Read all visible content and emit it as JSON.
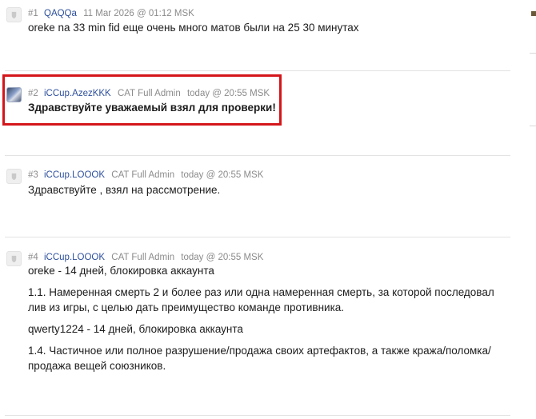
{
  "posts": [
    {
      "num": "#1",
      "user": "QAQQa",
      "role": "",
      "date": "11 Mar 2026 @ 01:12 MSK",
      "avatar_icon": "default-avatar-icon",
      "paragraphs": [
        "oreke na 33 min fid еще очень много матов были на 25 30 минутах"
      ]
    },
    {
      "num": "#2",
      "user": "iCCup.AzezKKK",
      "role": "CAT Full Admin",
      "date": "today @ 20:55 MSK",
      "avatar_icon": "user-photo-avatar",
      "paragraphs": [
        "Здравствуйте уважаемый взял для проверки!"
      ]
    },
    {
      "num": "#3",
      "user": "iCCup.LOOOK",
      "role": "CAT Full Admin",
      "date": "today @ 20:55 MSK",
      "avatar_icon": "default-avatar-icon",
      "paragraphs": [
        "Здравствуйте , взял на рассмотрение."
      ]
    },
    {
      "num": "#4",
      "user": "iCCup.LOOOK",
      "role": "CAT Full Admin",
      "date": "today @ 20:55 MSK",
      "avatar_icon": "default-avatar-icon",
      "paragraphs": [
        "oreke - 14 дней, блокировка аккаунта",
        "1.1. Намеренная смерть 2 и более раз или одна намеренная смерть, за которой последовал лив из игры, с целью дать преимущество команде противника.",
        "qwerty1224 - 14 дней, блокировка аккаунта",
        "1.4. Частичное или полное разрушение/продажа своих артефактов, а также кража/поломка/продажа вещей союзников."
      ]
    }
  ],
  "colors": {
    "username": "#2d4f9c",
    "meta": "#8b8b8b",
    "highlight_border": "#d4161b",
    "separator": "#e3e3e3"
  }
}
